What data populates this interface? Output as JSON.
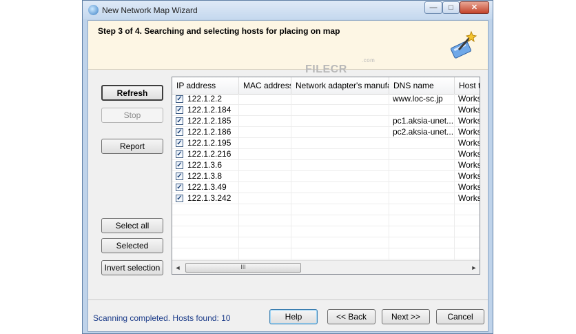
{
  "window": {
    "title": "New Network Map Wizard"
  },
  "controls": {
    "minimize": "—",
    "maximize": "□",
    "close": "✕"
  },
  "header": {
    "step": "Step 3 of 4. Searching and selecting hosts for placing on map"
  },
  "watermark": {
    "text": "FILECR",
    "sub": ".com"
  },
  "buttons": {
    "refresh": "Refresh",
    "stop": "Stop",
    "report": "Report",
    "select_all": "Select all",
    "selected": "Selected",
    "invert_selection": "Invert selection",
    "help": "Help",
    "back": "<< Back",
    "next": "Next >>",
    "cancel": "Cancel"
  },
  "grid": {
    "columns": [
      "IP address",
      "MAC address",
      "Network adapter's manufa...",
      "DNS name",
      "Host ty"
    ],
    "rows": [
      {
        "checked": true,
        "ip": "122.1.2.2",
        "mac": "",
        "adapter": "",
        "dns": "www.loc-sc.jp",
        "host": "Works"
      },
      {
        "checked": true,
        "ip": "122.1.2.184",
        "mac": "",
        "adapter": "",
        "dns": "",
        "host": "Works"
      },
      {
        "checked": true,
        "ip": "122.1.2.185",
        "mac": "",
        "adapter": "",
        "dns": "pc1.aksia-unet....",
        "host": "Works"
      },
      {
        "checked": true,
        "ip": "122.1.2.186",
        "mac": "",
        "adapter": "",
        "dns": "pc2.aksia-unet....",
        "host": "Works"
      },
      {
        "checked": true,
        "ip": "122.1.2.195",
        "mac": "",
        "adapter": "",
        "dns": "",
        "host": "Works"
      },
      {
        "checked": true,
        "ip": "122.1.2.216",
        "mac": "",
        "adapter": "",
        "dns": "",
        "host": "Works"
      },
      {
        "checked": true,
        "ip": "122.1.3.6",
        "mac": "",
        "adapter": "",
        "dns": "",
        "host": "Works"
      },
      {
        "checked": true,
        "ip": "122.1.3.8",
        "mac": "",
        "adapter": "",
        "dns": "",
        "host": "Works"
      },
      {
        "checked": true,
        "ip": "122.1.3.49",
        "mac": "",
        "adapter": "",
        "dns": "",
        "host": "Works"
      },
      {
        "checked": true,
        "ip": "122.1.3.242",
        "mac": "",
        "adapter": "",
        "dns": "",
        "host": "Works"
      }
    ],
    "empty_rows": 5,
    "scroll_left": "◄",
    "scroll_right": "►",
    "scroll_thumb": "III"
  },
  "status": {
    "text": "Scanning completed. Hosts found: 10"
  }
}
